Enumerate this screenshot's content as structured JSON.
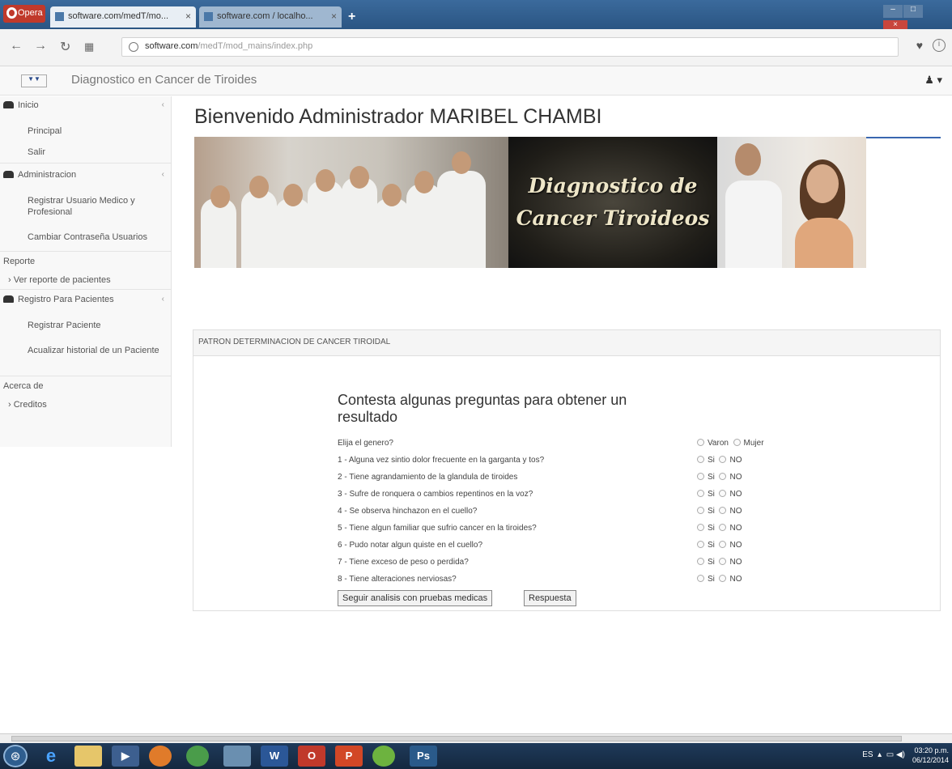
{
  "browser": {
    "menu_label": "Opera",
    "tabs": [
      {
        "label": "software.com/medT/mo..."
      },
      {
        "label": "software.com / localho..."
      }
    ],
    "url_domain": "software.com",
    "url_path": "/medT/mod_mains/index.php"
  },
  "header": {
    "logo_text": "▼▼",
    "brand": "Diagnostico en Cancer de Tiroides",
    "user_icon": "user-icon"
  },
  "sidebar": {
    "inicio": "Inicio",
    "principal": "Principal",
    "salir": "Salir",
    "administracion": "Administracion",
    "registrar_usuario": "Registrar Usuario Medico y Profesional",
    "cambiar_contrasena": "Cambiar Contraseña Usuarios",
    "reporte": "Reporte",
    "ver_reporte": "Ver reporte de pacientes",
    "registro_pacientes": "Registro Para Pacientes",
    "registrar_paciente": "Registrar Paciente",
    "actualizar_historial": "Acualizar historial de un Paciente",
    "acerca_de": "Acerca de",
    "creditos": "Creditos"
  },
  "main": {
    "welcome": "Bienvenido Administrador MARIBEL CHAMBI",
    "banner_title_line1": "Diagnostico de",
    "banner_title_line2": "Cancer Tiroideos",
    "panel_title": "PATRON DETERMINACION DE CANCER TIROIDAL",
    "form_title": "Contesta algunas preguntas para obtener un resultado",
    "gender_question": "Elija el genero?",
    "gender_options": [
      "Varon",
      "Mujer"
    ],
    "questions": [
      "1 - Alguna vez sintio dolor frecuente en la garganta y tos?",
      "2 - Tiene agrandamiento de la glandula de tiroides",
      "3 - Sufre de ronquera o cambios repentinos en la voz?",
      "4 - Se observa hinchazon en el cuello?",
      "5 - Tiene algun familiar que sufrio cancer en la tiroides?",
      "6 - Pudo notar algun quiste en el cuello?",
      "7 - Tiene exceso de peso o perdida?",
      "8 - Tiene alteraciones nerviosas?"
    ],
    "yes_label": "Si",
    "no_label": "NO",
    "btn_continue": "Seguir analisis con pruebas medicas",
    "btn_answer": "Respuesta"
  },
  "taskbar": {
    "lang": "ES",
    "time": "03:20 p.m.",
    "date": "06/12/2014"
  }
}
